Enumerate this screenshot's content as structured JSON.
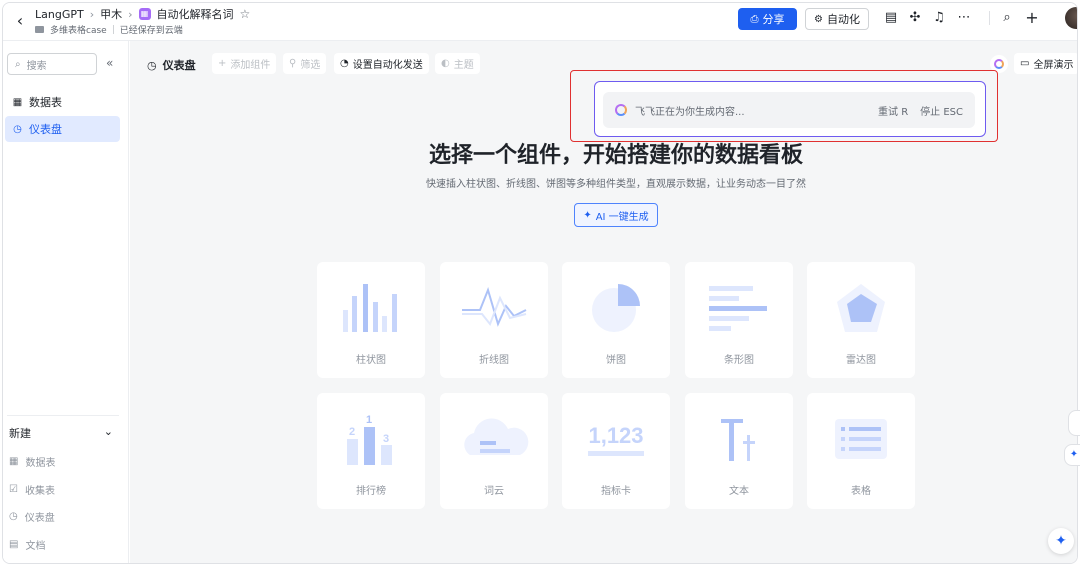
{
  "header": {
    "breadcrumbs": [
      "LangGPT",
      "甲木",
      "自动化解释名词"
    ],
    "sub_folder": "多维表格case",
    "save_status": "已经保存到云端",
    "share_label": "分享",
    "automation_label": "自动化"
  },
  "sidebar": {
    "search_placeholder": "搜索",
    "items": [
      {
        "label": "数据表",
        "icon": "table-icon"
      },
      {
        "label": "仪表盘",
        "icon": "dashboard-icon"
      }
    ],
    "new_label": "新建",
    "new_items": [
      {
        "label": "数据表",
        "icon": "table-icon"
      },
      {
        "label": "收集表",
        "icon": "form-icon"
      },
      {
        "label": "仪表盘",
        "icon": "dashboard-icon"
      },
      {
        "label": "文档",
        "icon": "doc-icon"
      }
    ]
  },
  "toolbar": {
    "title": "仪表盘",
    "add_widget": "添加组件",
    "filter": "筛选",
    "auto_send": "设置自动化发送",
    "theme": "主题",
    "fullscreen": "全屏演示"
  },
  "ai_panel": {
    "status": "飞飞正在为你生成内容...",
    "retry": "重试 R",
    "stop": "停止 ESC"
  },
  "hero": {
    "title": "选择一个组件，开始搭建你的数据看板",
    "subtitle": "快速插入柱状图、折线图、饼图等多种组件类型，直观展示数据，让业务动态一目了然",
    "ai_button": "AI 一键生成"
  },
  "widgets": [
    {
      "label": "柱状图",
      "icon": "bar-chart-icon"
    },
    {
      "label": "折线图",
      "icon": "line-chart-icon"
    },
    {
      "label": "饼图",
      "icon": "pie-chart-icon"
    },
    {
      "label": "条形图",
      "icon": "horizontal-bar-icon"
    },
    {
      "label": "雷达图",
      "icon": "radar-chart-icon"
    },
    {
      "label": "排行榜",
      "icon": "ranking-icon"
    },
    {
      "label": "词云",
      "icon": "word-cloud-icon"
    },
    {
      "label": "指标卡",
      "icon": "metric-card-icon"
    },
    {
      "label": "文本",
      "icon": "text-icon"
    },
    {
      "label": "表格",
      "icon": "table-widget-icon"
    }
  ],
  "widget_art": {
    "ranking_numbers": [
      "2",
      "1",
      "3"
    ],
    "metric_value": "1,123"
  },
  "colors": {
    "accent": "#1e5ff0",
    "active_bg": "#e1eaff",
    "widget_icon": "#c5d4fb",
    "widget_icon_dark": "#adc2f7",
    "highlight_red": "#e03131",
    "ai_border": "#6e5bf0"
  }
}
